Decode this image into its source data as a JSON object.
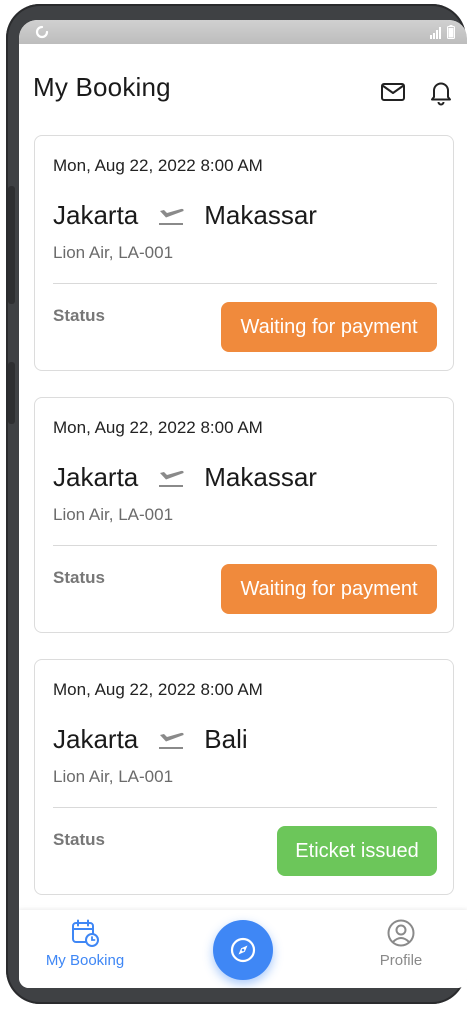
{
  "header": {
    "title": "My Booking",
    "icons": [
      "mail-icon",
      "bell-icon"
    ]
  },
  "bookings": [
    {
      "datetime": "Mon, Aug 22, 2022 8:00 AM",
      "from": "Jakarta",
      "to": "Makassar",
      "airline": "Lion Air, LA-001",
      "status_label": "Status",
      "status": "Waiting for payment",
      "status_color": "#F08A3C"
    },
    {
      "datetime": "Mon, Aug 22, 2022 8:00 AM",
      "from": "Jakarta",
      "to": "Makassar",
      "airline": "Lion Air, LA-001",
      "status_label": "Status",
      "status": "Waiting for payment",
      "status_color": "#F08A3C"
    },
    {
      "datetime": "Mon, Aug 22, 2022 8:00 AM",
      "from": "Jakarta",
      "to": "Bali",
      "airline": "Lion Air, LA-001",
      "status_label": "Status",
      "status": "Eticket issued",
      "status_color": "#6CC65A"
    }
  ],
  "nav": {
    "booking_label": "My Booking",
    "profile_label": "Profile",
    "active": "My Booking",
    "active_color": "#3F87F5",
    "inactive_color": "#8A8A8A",
    "fab_icon": "compass-icon"
  }
}
